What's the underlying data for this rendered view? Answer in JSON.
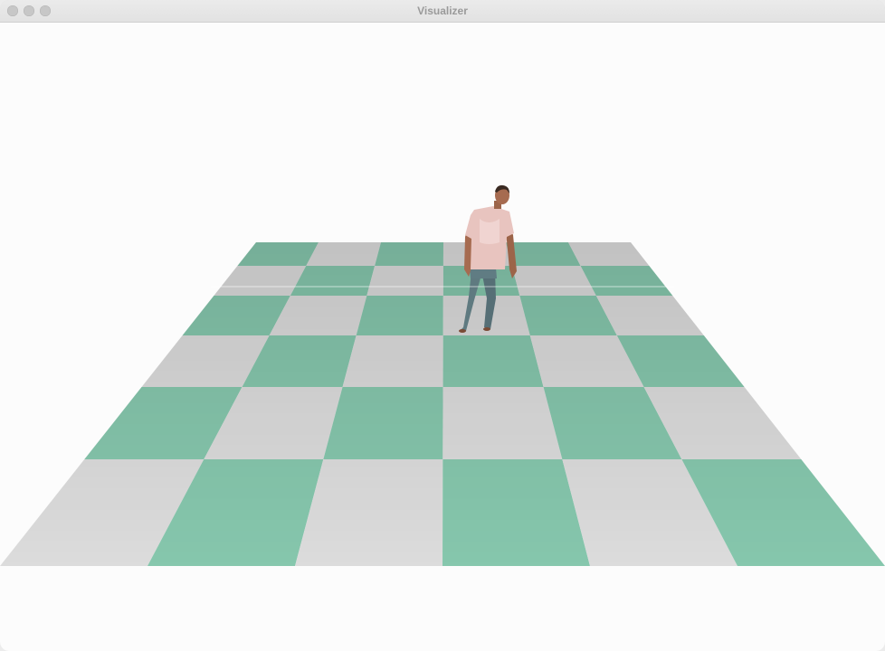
{
  "window": {
    "title": "Visualizer"
  },
  "colors": {
    "floor_green": "#86c7ad",
    "floor_gray": "#dcdcdc",
    "background": "#fcfcfc",
    "shirt": "#e8c4bf",
    "jeans": "#5f7a80",
    "skin": "#a66b50"
  },
  "icons": [
    "close-icon",
    "minimize-icon",
    "zoom-icon"
  ]
}
